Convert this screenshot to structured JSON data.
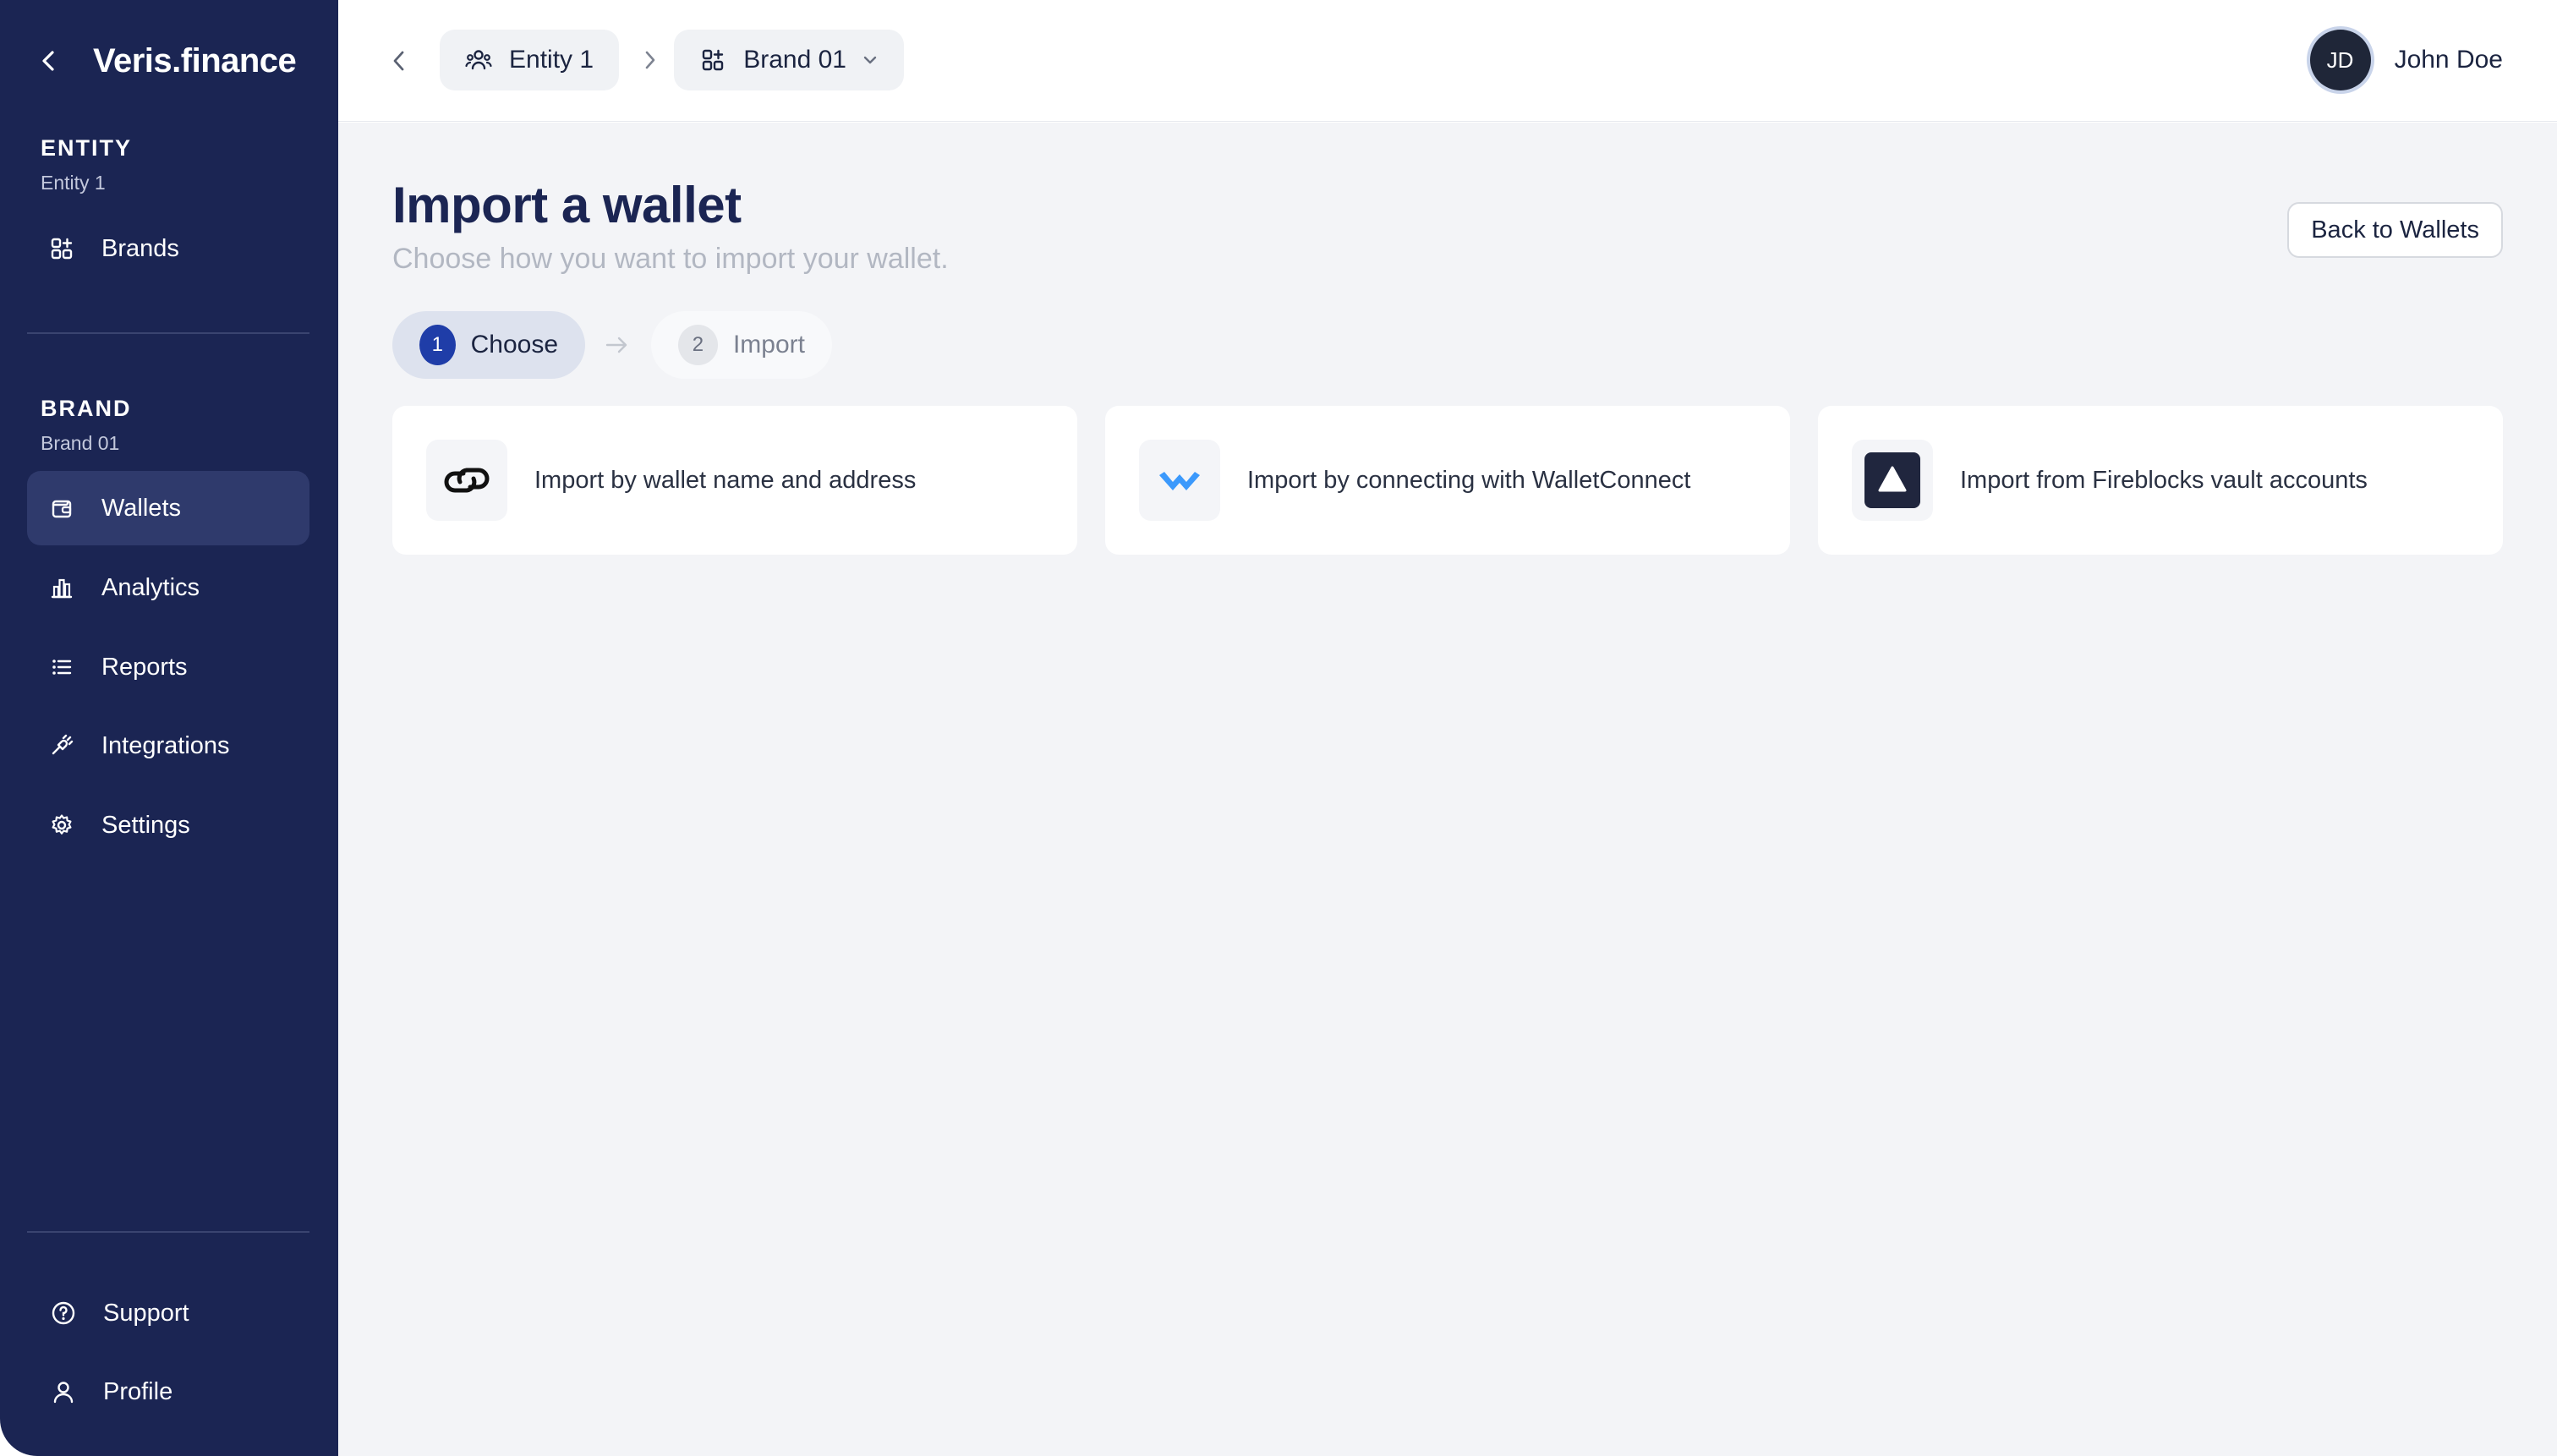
{
  "sidebar": {
    "logo": "Veris.finance",
    "entity_section": {
      "title": "ENTITY",
      "subtitle": "Entity 1"
    },
    "brand_section": {
      "title": "BRAND",
      "subtitle": "Brand 01"
    },
    "items": [
      {
        "label": "Brands",
        "icon": "grid-plus-icon"
      },
      {
        "label": "Wallets",
        "icon": "wallet-icon",
        "active": true
      },
      {
        "label": "Analytics",
        "icon": "bar-chart-icon"
      },
      {
        "label": "Reports",
        "icon": "list-icon"
      },
      {
        "label": "Integrations",
        "icon": "plug-icon"
      },
      {
        "label": "Settings",
        "icon": "gear-icon"
      }
    ],
    "footer": [
      {
        "label": "Support",
        "icon": "help-circle-icon"
      },
      {
        "label": "Profile",
        "icon": "user-icon"
      }
    ]
  },
  "header": {
    "breadcrumb": [
      {
        "label": "Entity 1",
        "icon": "users-icon"
      },
      {
        "label": "Brand 01",
        "icon": "grid-plus-icon"
      }
    ],
    "user": {
      "initials": "JD",
      "name": "John Doe"
    }
  },
  "main": {
    "title": "Import a wallet",
    "subtitle": "Choose how you want to import your wallet.",
    "back_button": "Back to Wallets",
    "steps": [
      {
        "number": "1",
        "label": "Choose",
        "active": true
      },
      {
        "number": "2",
        "label": "Import",
        "active": false
      }
    ],
    "options": [
      {
        "label": "Import by wallet name and address",
        "icon": "link-icon"
      },
      {
        "label": "Import by connecting with WalletConnect",
        "icon": "walletconnect-icon"
      },
      {
        "label": "Import from Fireblocks vault accounts",
        "icon": "fireblocks-icon"
      }
    ]
  },
  "colors": {
    "sidebar_bg": "#1b2553",
    "sidebar_active": "#2f3a6c",
    "accent": "#1f3da8",
    "walletconnect": "#3b99fc",
    "main_bg": "#f3f4f7"
  }
}
